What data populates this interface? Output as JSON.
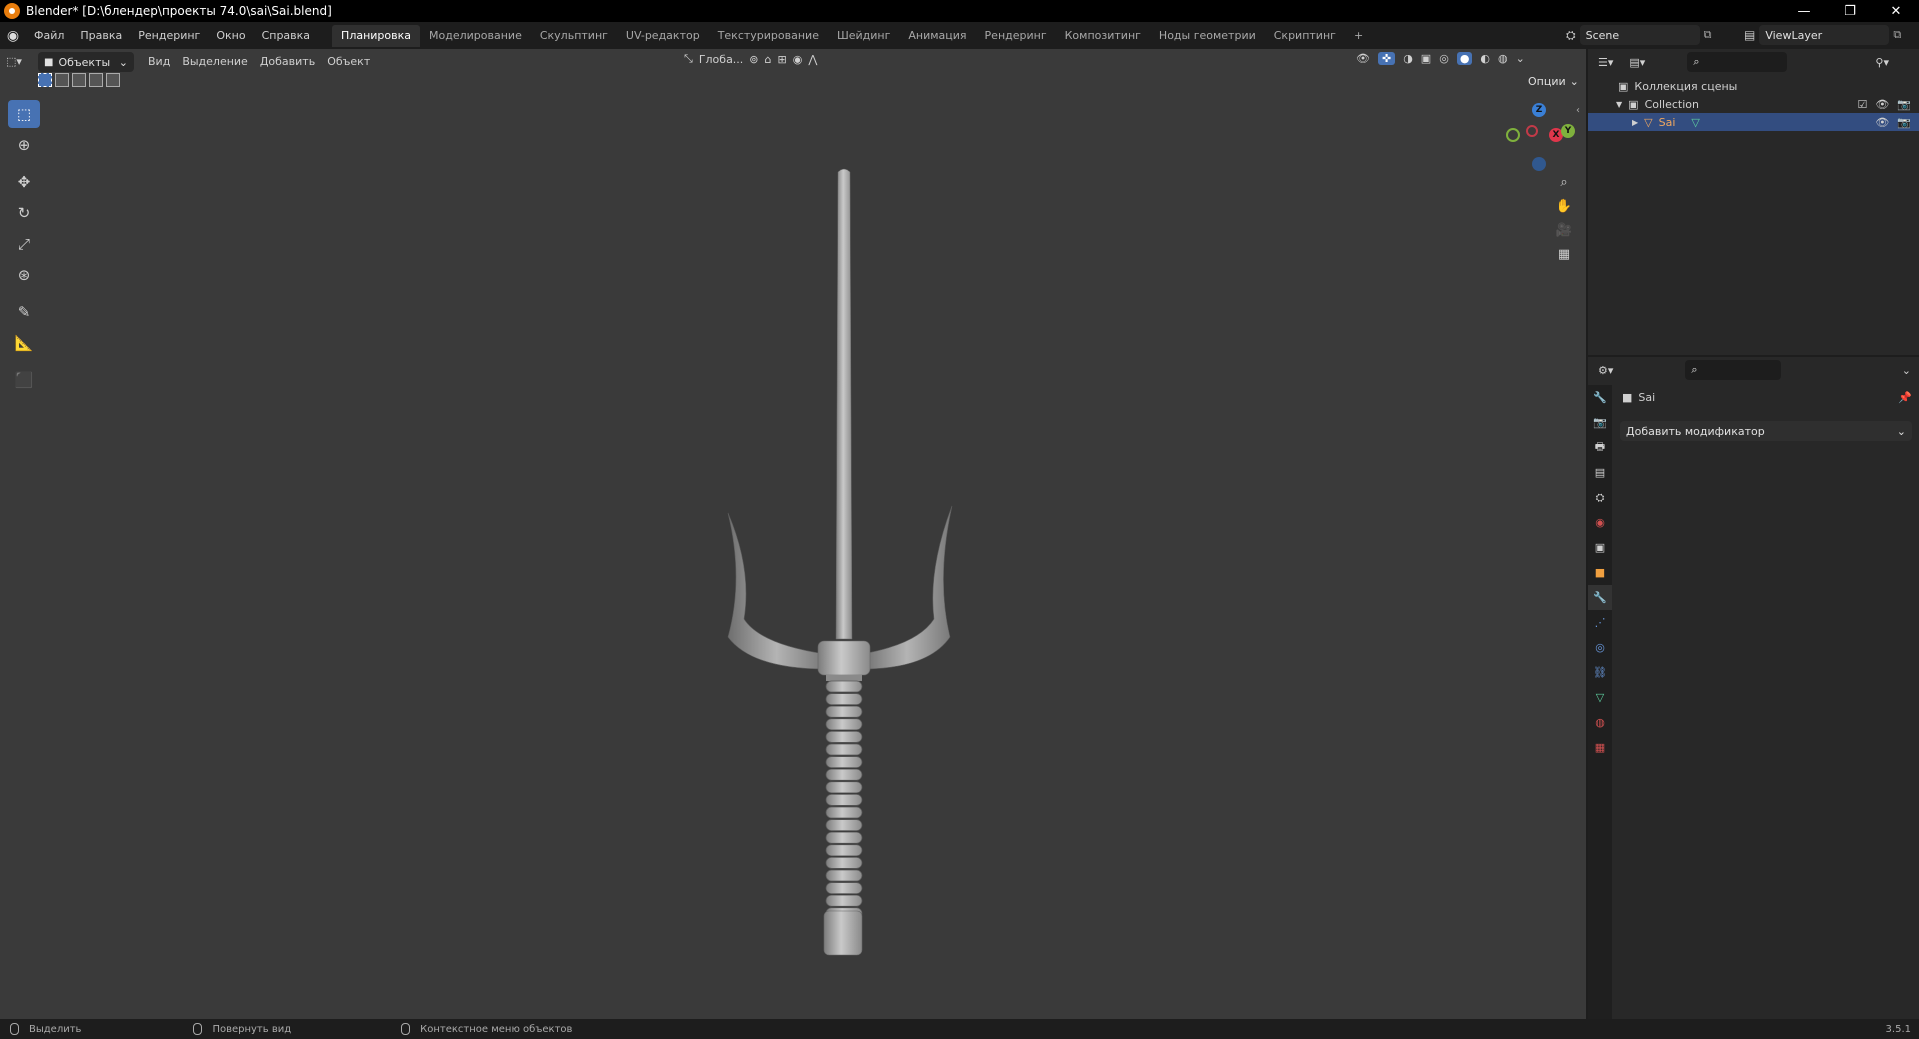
{
  "window": {
    "title": "Blender* [D:\\блендер\\проекты 74.0\\sai\\Sai.blend]",
    "minimize": "—",
    "maximize": "❐",
    "close": "✕"
  },
  "menu": {
    "items": [
      "Файл",
      "Правка",
      "Рендеринг",
      "Окно",
      "Справка"
    ]
  },
  "workspaces": {
    "tabs": [
      "Планировка",
      "Моделирование",
      "Скульптинг",
      "UV-редактор",
      "Текстурирование",
      "Шейдинг",
      "Анимация",
      "Рендеринг",
      "Композитинг",
      "Ноды геометрии",
      "Скриптинг"
    ],
    "active": 0,
    "add": "+"
  },
  "scene": {
    "name": "Scene",
    "view_layer": "ViewLayer"
  },
  "viewport_header": {
    "mode": "Объекты",
    "menus": [
      "Вид",
      "Выделение",
      "Добавить",
      "Объект"
    ],
    "orientation": "Глоба...",
    "options": "Опции"
  },
  "gizmo": {
    "z": "Z",
    "x": "X",
    "y": "Y",
    "colors": {
      "x": "#e0364b",
      "y": "#7fb13d",
      "z": "#3a7fd5"
    }
  },
  "outliner": {
    "root": "Коллекция сцены",
    "collection": "Collection",
    "object": "Sai"
  },
  "properties": {
    "object_name": "Sai",
    "add_modifier": "Добавить модификатор"
  },
  "statusbar": {
    "select": "Выделить",
    "rotate": "Повернуть вид",
    "context": "Контекстное меню объектов",
    "version": "3.5.1"
  },
  "colors": {
    "accent": "#4772b3",
    "viewport_bg": "#3a3a3a",
    "panel_bg": "#282828",
    "selected_row": "#334d80"
  }
}
